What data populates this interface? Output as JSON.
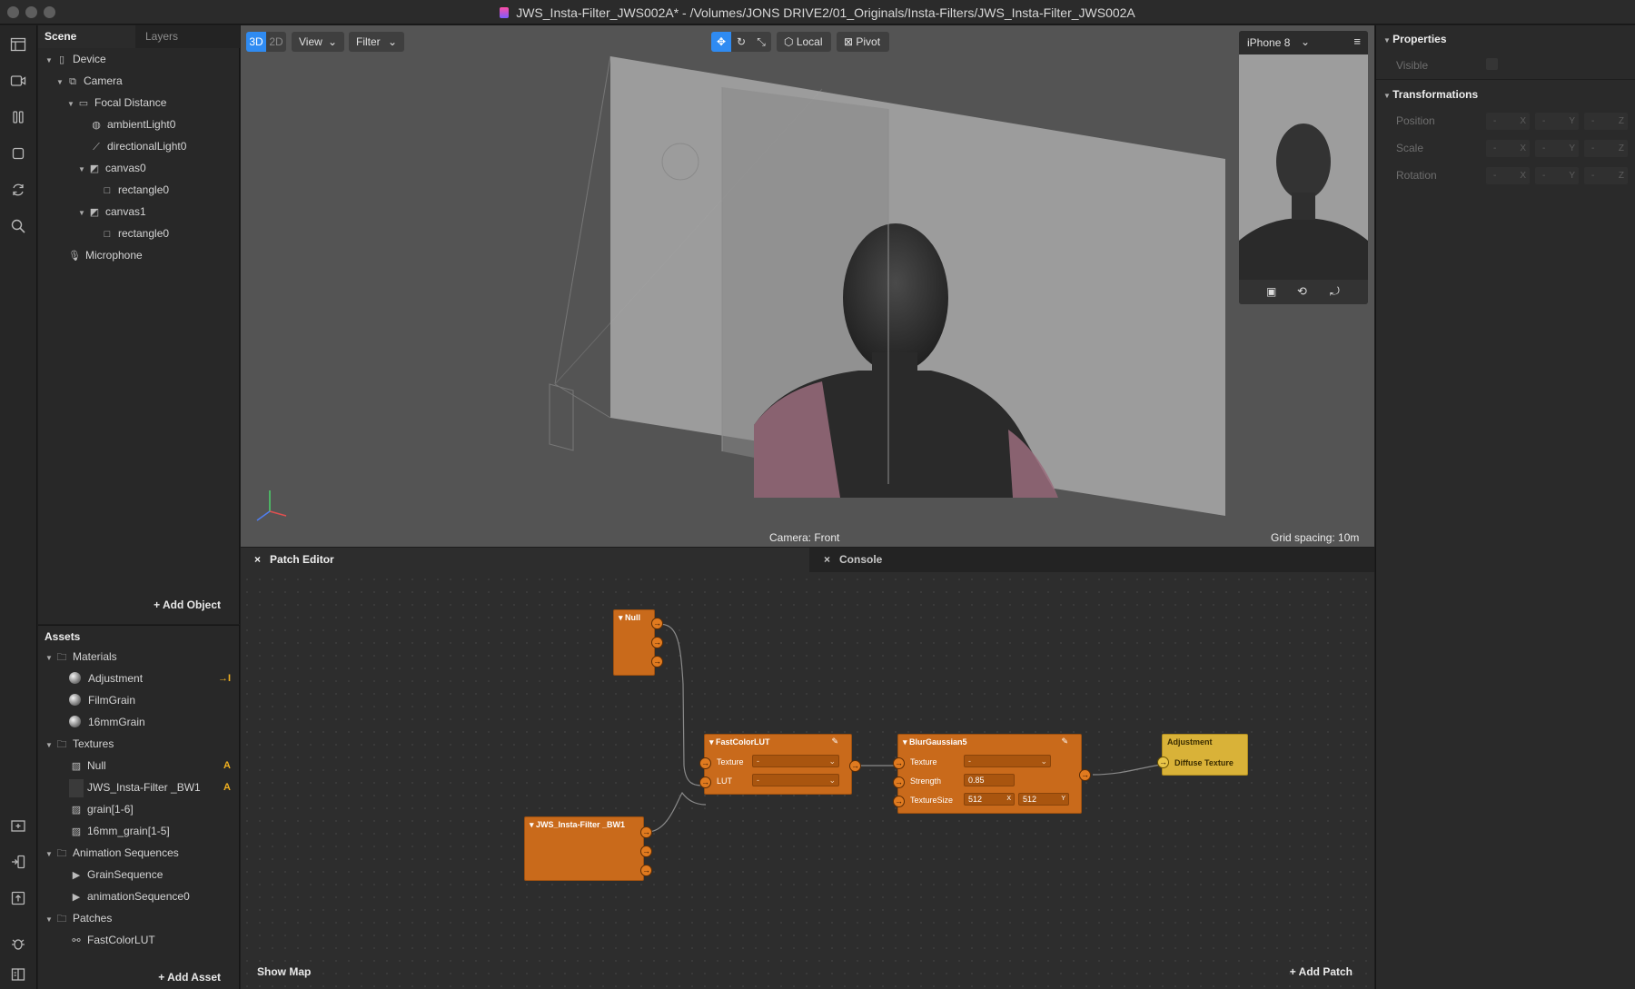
{
  "window": {
    "title": "JWS_Insta-Filter_JWS002A* - /Volumes/JONS DRIVE2/01_Originals/Insta-Filters/JWS_Insta-Filter_JWS002A"
  },
  "scene": {
    "tabs": [
      "Scene",
      "Layers"
    ],
    "tree": [
      {
        "label": "Device",
        "icon": "device-icon"
      },
      {
        "label": "Camera",
        "icon": "camera-icon"
      },
      {
        "label": "Focal Distance",
        "icon": "focal-distance-icon"
      },
      {
        "label": "ambientLight0",
        "icon": "ambient-light-icon"
      },
      {
        "label": "directionalLight0",
        "icon": "directional-light-icon"
      },
      {
        "label": "canvas0",
        "icon": "canvas-icon"
      },
      {
        "label": "rectangle0",
        "icon": "rectangle-icon"
      },
      {
        "label": "canvas1",
        "icon": "canvas-icon"
      },
      {
        "label": "rectangle0",
        "icon": "rectangle-icon"
      },
      {
        "label": "Microphone",
        "icon": "microphone-icon"
      }
    ],
    "add_object": "Add Object"
  },
  "assets": {
    "title": "Assets",
    "items": [
      {
        "label": "Materials",
        "icon": "folder-icon"
      },
      {
        "label": "Adjustment",
        "icon": "material-sphere-icon",
        "badge": "→I"
      },
      {
        "label": "FilmGrain",
        "icon": "material-sphere-icon"
      },
      {
        "label": "16mmGrain",
        "icon": "material-sphere-icon"
      },
      {
        "label": "Textures",
        "icon": "folder-icon"
      },
      {
        "label": "Null",
        "icon": "texture-icon",
        "badge": "A"
      },
      {
        "label": "JWS_Insta-Filter _BW1",
        "icon": "texture-icon",
        "badge": "A"
      },
      {
        "label": "grain[1-6]",
        "icon": "texture-icon"
      },
      {
        "label": "16mm_grain[1-5]",
        "icon": "texture-icon"
      },
      {
        "label": "Animation Sequences",
        "icon": "folder-icon"
      },
      {
        "label": "GrainSequence",
        "icon": "animation-sequence-icon"
      },
      {
        "label": "animationSequence0",
        "icon": "animation-sequence-icon"
      },
      {
        "label": "Patches",
        "icon": "folder-icon"
      },
      {
        "label": "FastColorLUT",
        "icon": "patch-icon"
      }
    ],
    "add_asset": "Add Asset"
  },
  "viewport": {
    "mode_3d": "3D",
    "mode_2d": "2D",
    "view": "View",
    "filter": "Filter",
    "local": "Local",
    "pivot": "Pivot",
    "device": "iPhone 8",
    "camera_label": "Camera: Front",
    "grid_spacing": "Grid spacing: 10m",
    "accent": "#2f8bf2"
  },
  "properties": {
    "title": "Properties",
    "visible": "Visible",
    "transformations": "Transformations",
    "rows": [
      {
        "label": "Position",
        "fields": [
          "-",
          "-",
          "-"
        ],
        "axes": [
          "X",
          "Y",
          "Z"
        ]
      },
      {
        "label": "Scale",
        "fields": [
          "-",
          "-",
          "-"
        ],
        "axes": [
          "X",
          "Y",
          "Z"
        ]
      },
      {
        "label": "Rotation",
        "fields": [
          "-",
          "-",
          "-"
        ],
        "axes": [
          "X",
          "Y",
          "Z"
        ]
      }
    ]
  },
  "patch_editor": {
    "tab": "Patch Editor",
    "console": "Console",
    "show_map": "Show Map",
    "add_patch": "Add Patch",
    "nodes": {
      "null": {
        "title": "Null"
      },
      "fastcolorlut": {
        "title": "FastColorLUT",
        "inputs": [
          "Texture",
          "LUT"
        ],
        "values": [
          "-",
          "-"
        ]
      },
      "blur": {
        "title": "BlurGaussian5",
        "inputs": [
          "Texture",
          "Strength",
          "TextureSize"
        ],
        "texture": "-",
        "strength": "0.85",
        "size_x": "512",
        "size_y": "512",
        "x_label": "X",
        "y_label": "Y"
      },
      "bw1": {
        "title": "JWS_Insta-Filter _BW1"
      },
      "adjustment": {
        "title": "Adjustment",
        "input": "Diffuse Texture"
      }
    },
    "colors": {
      "node": "#c96a1b",
      "output": "#d9b238"
    }
  }
}
